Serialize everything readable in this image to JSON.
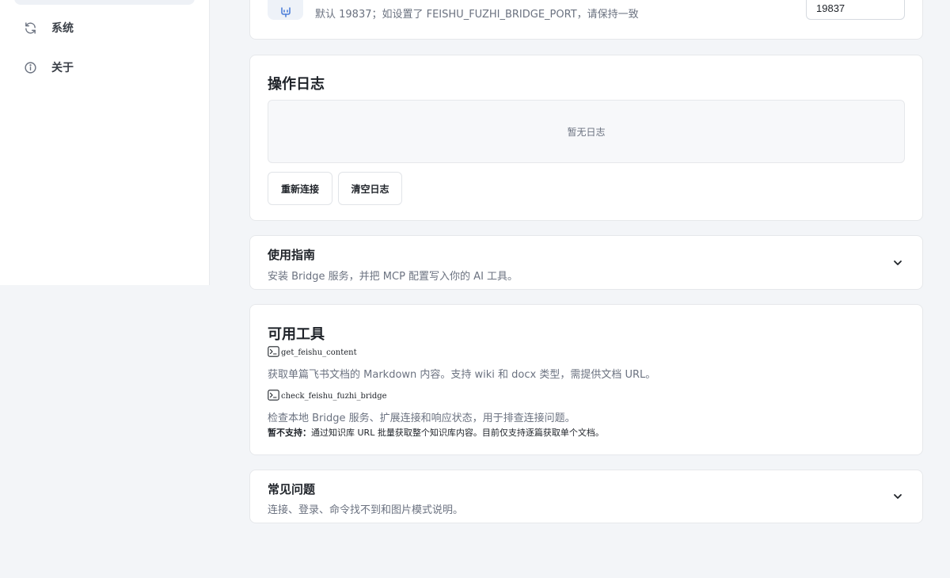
{
  "sidebar": {
    "items": [
      {
        "label": "系统",
        "icon": "refresh-icon"
      },
      {
        "label": "关于",
        "icon": "info-icon"
      }
    ]
  },
  "port_card": {
    "description": "默认 19837；如设置了 FEISHU_FUZHI_BRIDGE_PORT，请保持一致",
    "value": "19837",
    "icon": "plug-icon"
  },
  "log_card": {
    "title": "操作日志",
    "empty_text": "暂无日志",
    "reconnect_label": "重新连接",
    "clear_label": "清空日志"
  },
  "guide_card": {
    "title": "使用指南",
    "description": "安装 Bridge 服务，并把 MCP 配置写入你的 AI 工具。",
    "icon": "chevron-down-icon"
  },
  "tools_card": {
    "title": "可用工具",
    "tools": [
      {
        "name": "get_feishu_content",
        "description": "获取单篇飞书文档的 Markdown 内容。支持 wiki 和 docx 类型，需提供文档 URL。",
        "icon": "terminal-icon"
      },
      {
        "name": "check_feishu_fuzhi_bridge",
        "description": "检查本地 Bridge 服务、扩展连接和响应状态，用于排查连接问题。",
        "icon": "terminal-icon"
      }
    ],
    "note_label": "暂不支持：",
    "note_text": "通过知识库 URL 批量获取整个知识库内容。目前仅支持逐篇获取单个文档。"
  },
  "faq_card": {
    "title": "常见问题",
    "description": "连接、登录、命令找不到和图片模式说明。",
    "icon": "chevron-down-icon"
  }
}
